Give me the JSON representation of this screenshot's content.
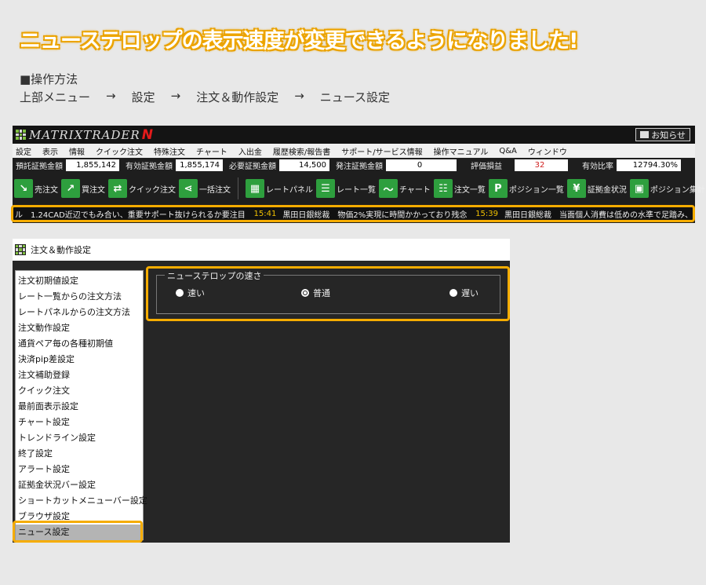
{
  "headline": "ニューステロップの表示速度が変更できるようになりました!",
  "howto_label": "■操作方法",
  "path": [
    "上部メニュー",
    "→",
    "設定",
    "→",
    "注文＆動作設定",
    "→",
    "ニュース設定"
  ],
  "app": {
    "brand": "MATRIXTRADER",
    "brand_mark": "N",
    "notice_label": "お知らせ",
    "menu": [
      "設定",
      "表示",
      "情報",
      "クイック注文",
      "特殊注文",
      "チャート",
      "入出金",
      "履歴検索/報告書",
      "サポート/サービス情報",
      "操作マニュアル",
      "Q&A",
      "ウィンドウ"
    ],
    "stats": [
      {
        "label": "預託証拠金額",
        "value": "1,855,142"
      },
      {
        "label": "有効証拠金額",
        "value": "1,855,174"
      },
      {
        "label": "必要証拠金額",
        "value": "14,500"
      },
      {
        "label": "発注証拠金額",
        "value": "0"
      },
      {
        "label": "評価損益",
        "value": "32"
      },
      {
        "label": "有効比率",
        "value": "12794.30%"
      }
    ],
    "toolbar": [
      "売注文",
      "買注文",
      "クイック注文",
      "一括注文",
      "レートパネル",
      "レート一覧",
      "チャート",
      "注文一覧",
      "ポジション一覧",
      "証拠金状況",
      "ポジション集計"
    ],
    "ticker": {
      "item1": "ル　1.24CAD近辺でもみ合い、重要サポート抜けられるか要注目",
      "time2": "15:41",
      "item2": "黒田日銀総裁　物価2%実現に時間かかっており残念",
      "time3": "15:39",
      "item3": "黒田日銀総裁　当面個人消費は低めの水準で足踏み、"
    }
  },
  "dialog": {
    "title": "注文＆動作設定",
    "menu": [
      "注文初期値設定",
      "レート一覧からの注文方法",
      "レートパネルからの注文方法",
      "注文動作設定",
      "通貨ペア毎の各種初期値",
      "決済pip差設定",
      "注文補助登録",
      "クイック注文",
      "最前面表示設定",
      "チャート設定",
      "トレンドライン設定",
      "終了設定",
      "アラート設定",
      "証拠金状況バー設定",
      "ショートカットメニューバー設定",
      "ブラウザ設定",
      "ニュース設定"
    ],
    "selected": "ニュース設定",
    "group_title": "ニューステロップの速さ",
    "options": [
      "速い",
      "普通",
      "遅い"
    ],
    "checked_option": "普通"
  },
  "colors": {
    "highlight": "#f5ac00",
    "app_bg": "#1e1e1e",
    "accent_green": "#2e9f3e"
  }
}
